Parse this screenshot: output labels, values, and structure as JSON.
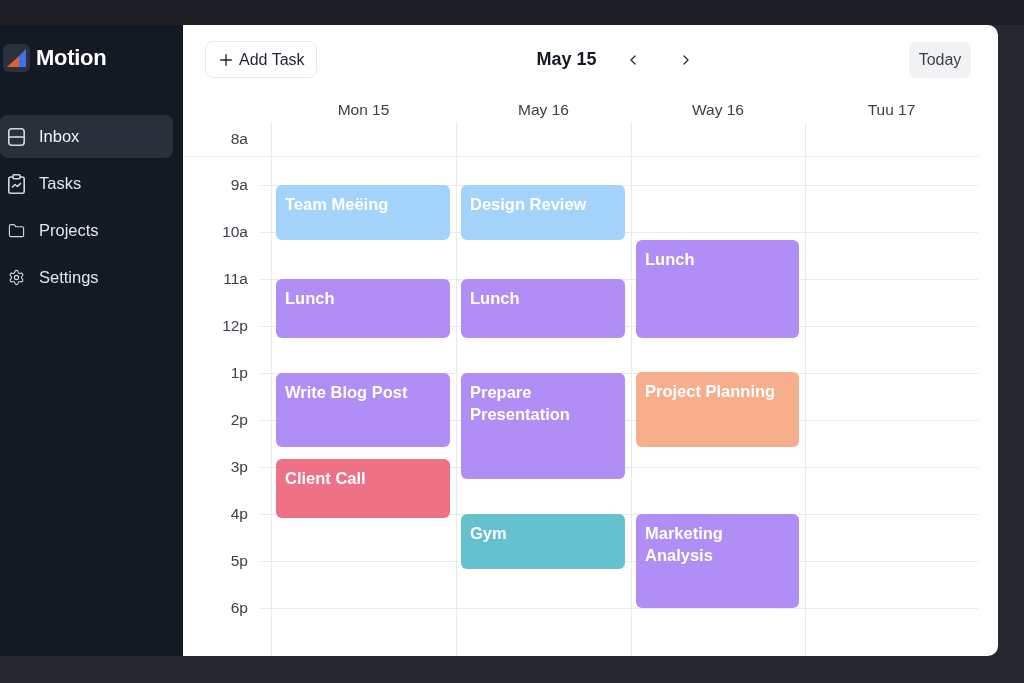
{
  "sidebar": {
    "logo_text": "Motion",
    "items": [
      {
        "label": "Inbox",
        "selected": true
      },
      {
        "label": "Tasks",
        "selected": false
      },
      {
        "label": "Projects",
        "selected": false
      },
      {
        "label": "Settings",
        "selected": false
      }
    ]
  },
  "toolbar": {
    "add_task": "Add Task",
    "title": "May 15",
    "today": "Today"
  },
  "calendar": {
    "hours": [
      "8a",
      "9a",
      "10a",
      "11a",
      "12p",
      "1p",
      "2p",
      "3p",
      "4p",
      "5p",
      "6p"
    ],
    "days": [
      {
        "label": "Mon 15",
        "events": [
          {
            "title": "Team Meëing",
            "color": "#a3d3fa"
          },
          {
            "title": "Lunch",
            "color": "#b08ef5"
          },
          {
            "title": "Write Blog Post",
            "color": "#b08ef5"
          },
          {
            "title": "Client Call",
            "color": "#ee7186"
          }
        ]
      },
      {
        "label": "May 16",
        "events": [
          {
            "title": "Design Review",
            "color": "#a3d3fa"
          },
          {
            "title": "Lunch",
            "color": "#b08ef5"
          },
          {
            "title": "Prepare Presentation",
            "color": "#b08ef5"
          },
          {
            "title": "Gym",
            "color": "#66c1cf"
          }
        ]
      },
      {
        "label": "Way 16",
        "events": [
          {
            "title": "Lunch",
            "color": "#b08ef5"
          },
          {
            "title": "Project Planning",
            "color": "#f6ae8c"
          },
          {
            "title": "Marketing Analysis",
            "color": "#b08ef5"
          }
        ]
      },
      {
        "label": "Tuu 17"
      }
    ]
  }
}
